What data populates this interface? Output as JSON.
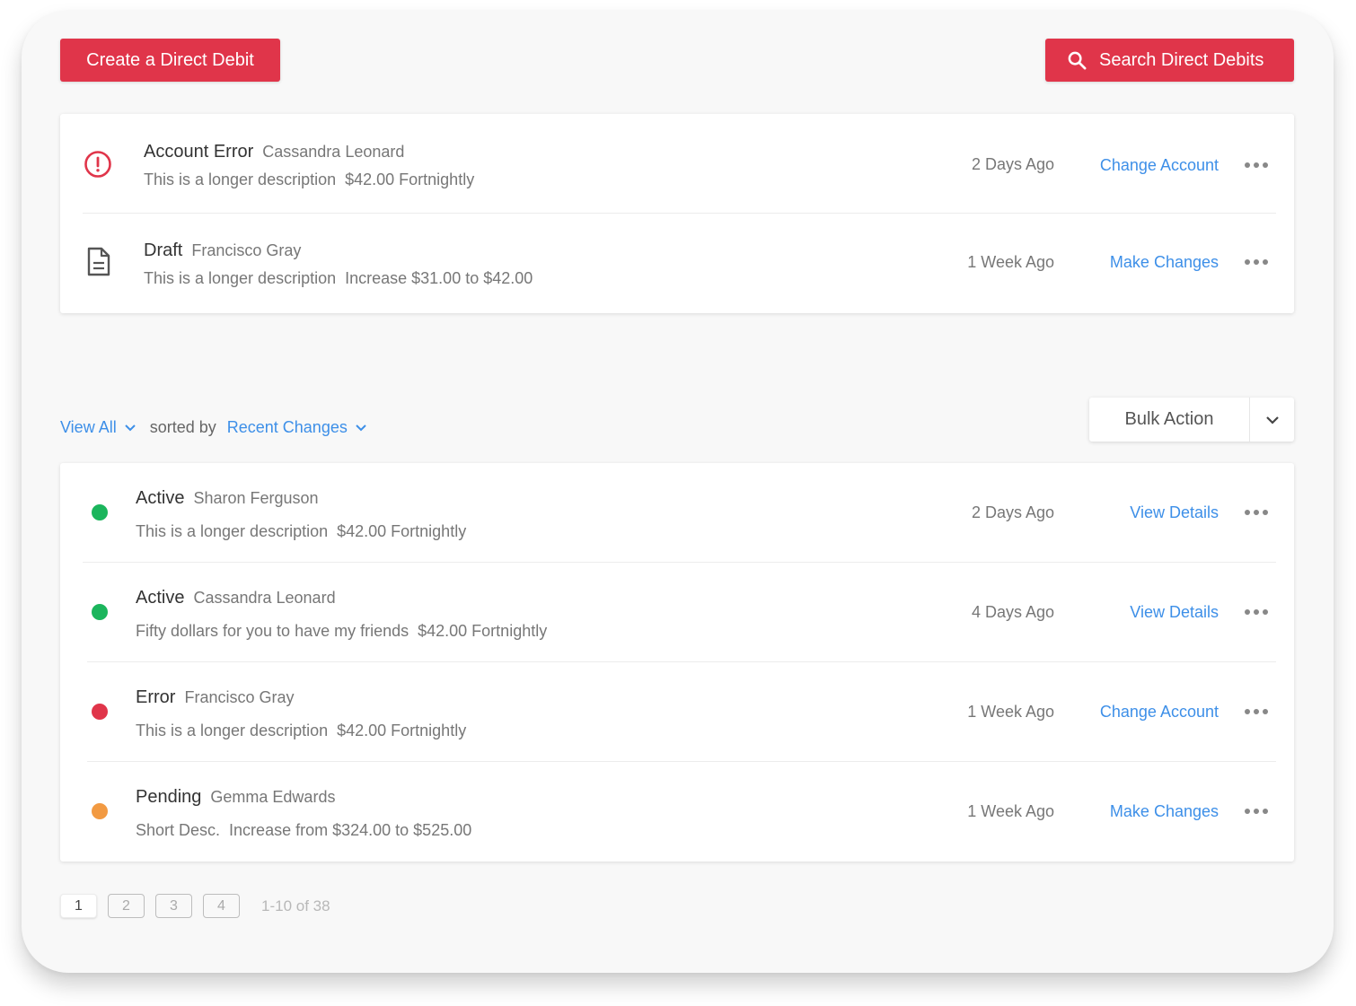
{
  "toolbar": {
    "create_label": "Create a Direct Debit",
    "search_label": "Search Direct Debits"
  },
  "attention": [
    {
      "status": "Account Error",
      "name": "Cassandra Leonard",
      "description": "This is a longer description",
      "amount": "$42.00 Fortnightly",
      "time": "2 Days Ago",
      "action": "Change Account",
      "icon": "alert-circle-icon"
    },
    {
      "status": "Draft",
      "name": "Francisco Gray",
      "description": "This is a longer description",
      "amount": "Increase $31.00 to $42.00",
      "time": "1 Week Ago",
      "action": "Make Changes",
      "icon": "document-icon"
    }
  ],
  "filters": {
    "view": "View All",
    "sorted_by": "sorted by",
    "sort": "Recent Changes"
  },
  "bulk_action": {
    "label": "Bulk Action"
  },
  "list": [
    {
      "status": "Active",
      "name": "Sharon Ferguson",
      "description": "This is a longer description",
      "amount": "$42.00 Fortnightly",
      "time": "2 Days Ago",
      "action": "View Details",
      "status_color": "#1bb55c"
    },
    {
      "status": "Active",
      "name": "Cassandra Leonard",
      "description": "Fifty dollars for you to have my friends",
      "amount": "$42.00 Fortnightly",
      "time": "4 Days Ago",
      "action": "View Details",
      "status_color": "#1bb55c"
    },
    {
      "status": "Error",
      "name": "Francisco Gray",
      "description": "This is a longer description",
      "amount": "$42.00 Fortnightly",
      "time": "1 Week Ago",
      "action": "Change Account",
      "status_color": "#e0354a"
    },
    {
      "status": "Pending",
      "name": "Gemma Edwards",
      "description": "Short Desc.",
      "amount": "Increase from $324.00 to $525.00",
      "time": "1 Week Ago",
      "action": "Make Changes",
      "status_color": "#f29a42"
    }
  ],
  "pagination": {
    "pages": [
      "1",
      "2",
      "3",
      "4"
    ],
    "current": "1",
    "info": "1-10 of 38"
  },
  "colors": {
    "brand": "#e0354a",
    "link": "#3d8fe8"
  }
}
